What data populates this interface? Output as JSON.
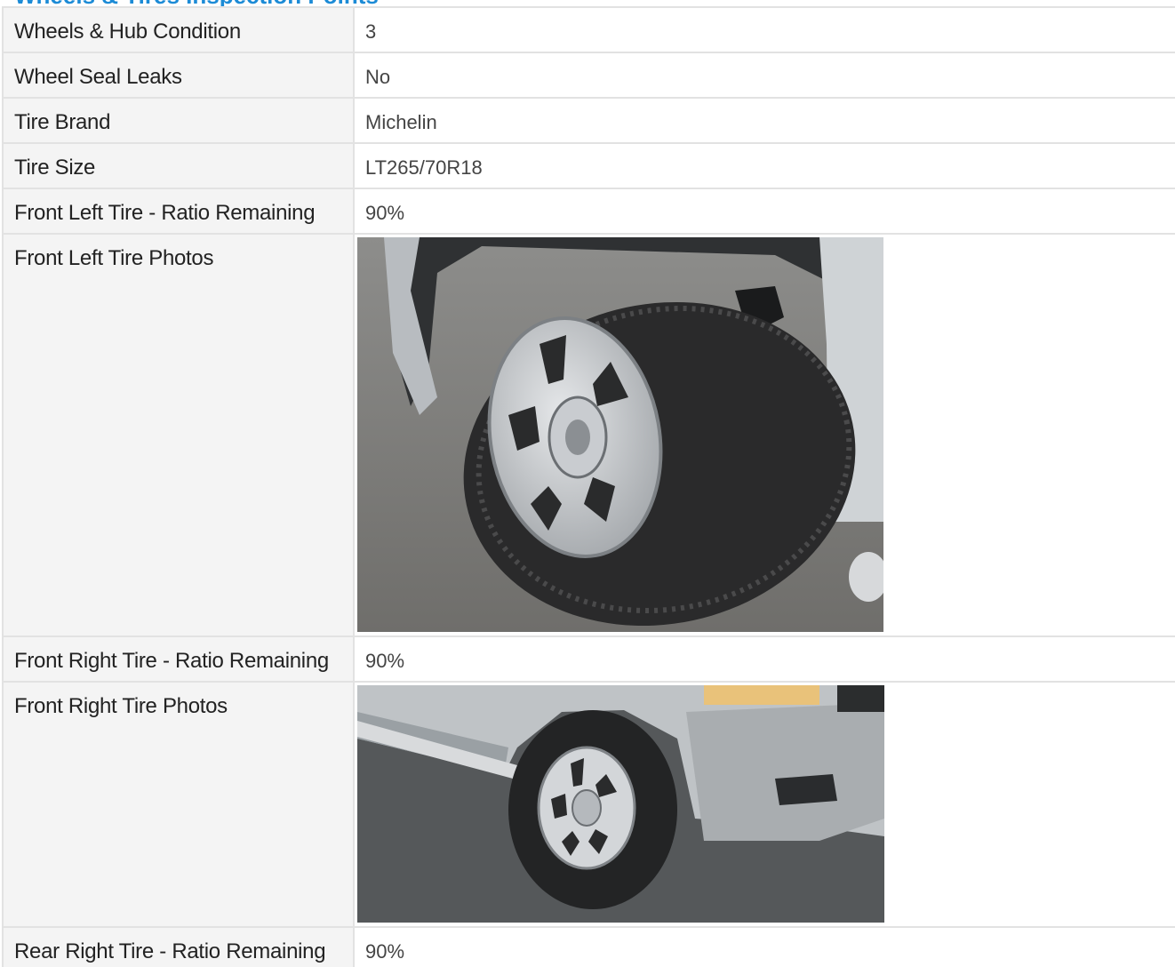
{
  "section": {
    "title": "Wheels & Tires Inspection Points"
  },
  "rows": [
    {
      "label": "Wheels & Hub Condition",
      "value": "3"
    },
    {
      "label": "Wheel Seal Leaks",
      "value": "No"
    },
    {
      "label": "Tire Brand",
      "value": "Michelin"
    },
    {
      "label": "Tire Size",
      "value": "LT265/70R18"
    },
    {
      "label": "Front Left Tire - Ratio Remaining",
      "value": "90%"
    },
    {
      "label": "Front Left Tire Photos"
    },
    {
      "label": "Front Right Tire - Ratio Remaining",
      "value": "90%"
    },
    {
      "label": "Front Right Tire Photos"
    },
    {
      "label": "Rear Right Tire - Ratio Remaining",
      "value": "90%"
    }
  ],
  "photos": {
    "front_left": {
      "subject": "front-left-tire-photo"
    },
    "front_right": {
      "subject": "front-right-tire-photo"
    }
  },
  "colors": {
    "title": "#1c8bd6",
    "label_bg": "#f4f4f4",
    "border": "#e2e2e2"
  }
}
